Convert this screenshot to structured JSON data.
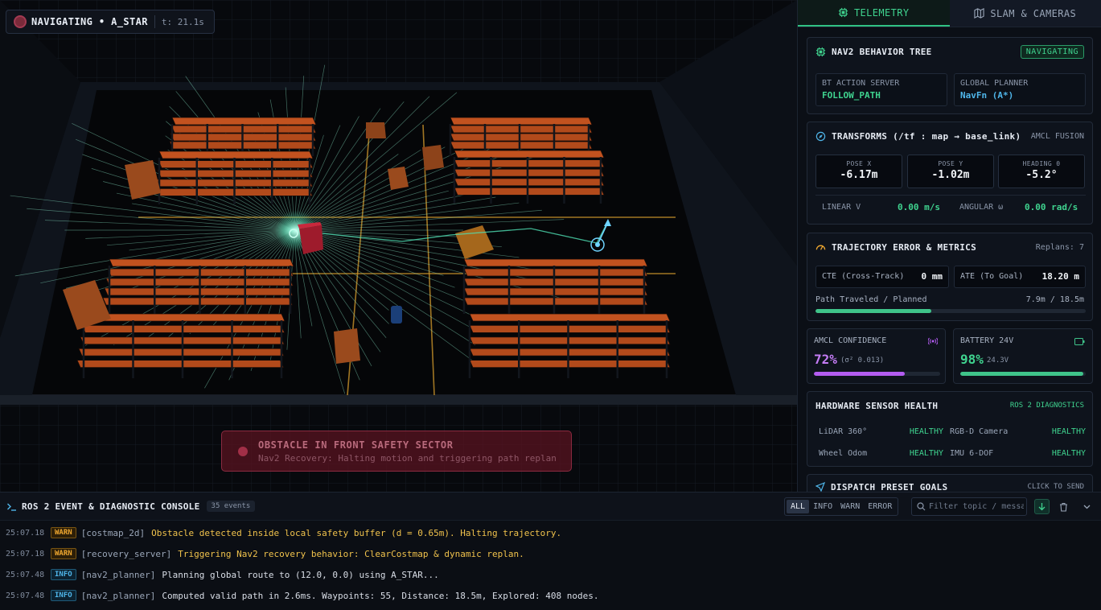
{
  "status": {
    "mode": "NAVIGATING • A_STAR",
    "time": "t: 21.1s"
  },
  "alert": {
    "title": "OBSTACLE IN FRONT SAFETY SECTOR",
    "subtitle": "Nav2 Recovery: Halting motion and triggering path replan"
  },
  "tabs": [
    {
      "label": "TELEMETRY"
    },
    {
      "label": "SLAM & CAMERAS"
    }
  ],
  "bt": {
    "title": "NAV2 BEHAVIOR TREE",
    "badge": "NAVIGATING",
    "action_label": "BT ACTION SERVER",
    "action_value": "FOLLOW_PATH",
    "planner_label": "GLOBAL PLANNER",
    "planner_value": "NavFn (A*)"
  },
  "tf": {
    "title": "TRANSFORMS (/tf : map → base_link)",
    "tag": "AMCL FUSION",
    "pose_x_label": "POSE X",
    "pose_x": "-6.17m",
    "pose_y_label": "POSE Y",
    "pose_y": "-1.02m",
    "heading_label": "HEADING θ",
    "heading": "-5.2°",
    "lin_label": "LINEAR V",
    "lin_value": "0.00 m/s",
    "ang_label": "ANGULAR ω",
    "ang_value": "0.00 rad/s"
  },
  "traj": {
    "title": "TRAJECTORY ERROR & METRICS",
    "replans": "Replans: 7",
    "cte_label": "CTE (Cross-Track)",
    "cte_value": "0 mm",
    "ate_label": "ATE (To Goal)",
    "ate_value": "18.20 m",
    "path_label": "Path Traveled / Planned",
    "path_value": "7.9m / 18.5m",
    "path_fraction": 0.43
  },
  "amcl": {
    "title": "AMCL CONFIDENCE",
    "value": "72%",
    "detail": "(σ² 0.013)",
    "fraction": 0.72,
    "color": "#b35cf0"
  },
  "battery": {
    "title": "BATTERY 24V",
    "value": "98%",
    "detail": "24.3V",
    "fraction": 0.98,
    "color": "#3fc48a"
  },
  "health": {
    "title": "HARDWARE SENSOR HEALTH",
    "tag": "ROS 2 DIAGNOSTICS",
    "items": [
      {
        "name": "LiDAR 360°",
        "state": "HEALTHY"
      },
      {
        "name": "RGB-D Camera",
        "state": "HEALTHY"
      },
      {
        "name": "Wheel Odom",
        "state": "HEALTHY"
      },
      {
        "name": "IMU 6-DOF",
        "state": "HEALTHY"
      }
    ]
  },
  "dispatch": {
    "title": "DISPATCH PRESET GOALS",
    "tag": "CLICK TO SEND"
  },
  "console": {
    "title": "ROS 2 EVENT & DIAGNOSTIC CONSOLE",
    "count": "35 events",
    "filters": [
      "ALL",
      "INFO",
      "WARN",
      "ERROR"
    ],
    "search_placeholder": "Filter topic / message...",
    "logs": [
      {
        "time": "25:07.18",
        "level": "WARN",
        "source": "[costmap_2d]",
        "message": "Obstacle detected inside local safety buffer (d = 0.65m). Halting trajectory."
      },
      {
        "time": "25:07.18",
        "level": "WARN",
        "source": "[recovery_server]",
        "message": "Triggering Nav2 recovery behavior: ClearCostmap & dynamic replan."
      },
      {
        "time": "25:07.48",
        "level": "INFO",
        "source": "[nav2_planner]",
        "message": "Planning global route to (12.0, 0.0) using A_STAR..."
      },
      {
        "time": "25:07.48",
        "level": "INFO",
        "source": "[nav2_planner]",
        "message": "Computed valid path in 2.6ms. Waypoints: 55, Distance: 18.5m, Explored: 408 nodes."
      }
    ]
  }
}
